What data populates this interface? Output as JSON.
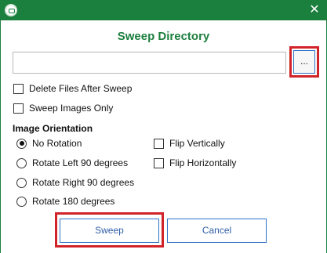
{
  "window": {
    "title_icon": "app-logo-icon",
    "close_glyph": "✕"
  },
  "dialog": {
    "heading": "Sweep Directory",
    "directory": {
      "value": "",
      "placeholder": ""
    },
    "browse_label": "...",
    "options": [
      {
        "label": "Delete Files After Sweep",
        "checked": false
      },
      {
        "label": "Sweep Images Only",
        "checked": false
      }
    ],
    "orientation": {
      "label": "Image Orientation",
      "radios": [
        {
          "label": "No Rotation",
          "checked": true
        },
        {
          "label": "Rotate Left 90 degrees",
          "checked": false
        },
        {
          "label": "Rotate Right 90 degrees",
          "checked": false
        },
        {
          "label": "Rotate 180 degrees",
          "checked": false
        }
      ],
      "flips": [
        {
          "label": "Flip Vertically",
          "checked": false
        },
        {
          "label": "Flip Horizontally",
          "checked": false
        }
      ]
    },
    "buttons": {
      "sweep": "Sweep",
      "cancel": "Cancel"
    }
  },
  "colors": {
    "titlebar": "#1b7f3e",
    "heading": "#1b7f3e",
    "highlight": "#d1232a",
    "button_border": "#2f73c7"
  }
}
